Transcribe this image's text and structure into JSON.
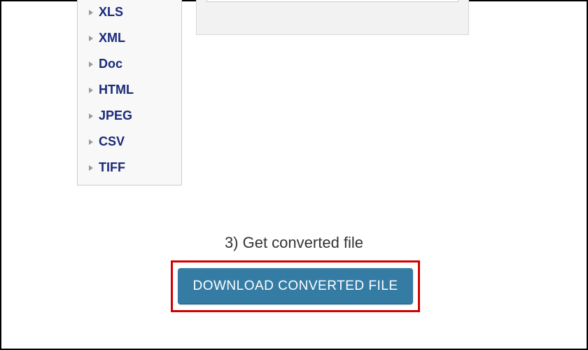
{
  "sidebar": {
    "items": [
      {
        "label": "XLS"
      },
      {
        "label": "XML"
      },
      {
        "label": "Doc"
      },
      {
        "label": "HTML"
      },
      {
        "label": "JPEG"
      },
      {
        "label": "CSV"
      },
      {
        "label": "TIFF"
      }
    ]
  },
  "step": {
    "label": "3) Get converted file"
  },
  "download": {
    "button_label": "DOWNLOAD CONVERTED FILE"
  },
  "colors": {
    "link": "#1a2a7a",
    "button_bg": "#357ca5",
    "highlight_border": "#d40000"
  }
}
